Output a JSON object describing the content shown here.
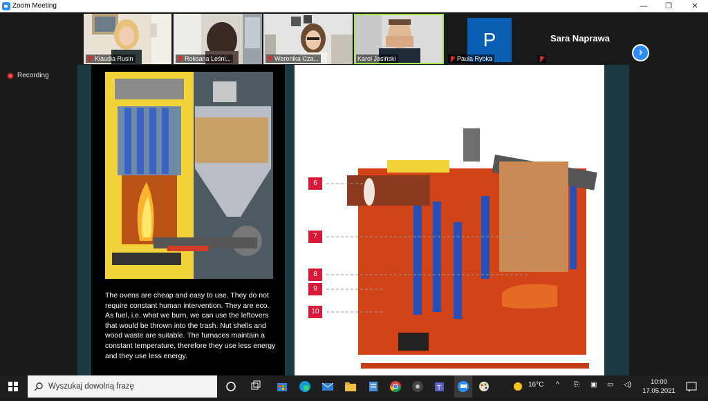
{
  "window": {
    "title": "Zoom Meeting",
    "controls": {
      "minimize": "—",
      "restore": "❐",
      "close": "✕"
    }
  },
  "participants": [
    {
      "name": "Klaudia Rusin",
      "muted": true,
      "video": true
    },
    {
      "name": "Roksana Leśni...",
      "muted": true,
      "video": true
    },
    {
      "name": "Weronika Cza...",
      "muted": true,
      "video": true
    },
    {
      "name": "Karol Jasiński",
      "muted": false,
      "video": true,
      "speaking": true
    },
    {
      "name": "Paula Rybka",
      "muted": true,
      "video": false,
      "avatar_letter": "P",
      "avatar_color": "#0a5fb4"
    },
    {
      "name": "Sara Naprawa",
      "muted": true,
      "video": false
    }
  ],
  "recording": {
    "label": "Recording"
  },
  "next_button": {
    "glyph": "›"
  },
  "slide": {
    "body_text": "The ovens are cheap and easy to use. They do not require constant human intervention. They are eco. As fuel, i.e. what we burn, we can use the leftovers that would be thrown into the trash. Nut shells and wood waste are suitable. The furnaces maintain a constant temperature, therefore they use less energy and they use less energy.",
    "callouts": [
      "6",
      "7",
      "8",
      "9",
      "10"
    ],
    "callout_color": "#d8193a"
  },
  "taskbar": {
    "search_placeholder": "Wyszukaj dowolną frazę",
    "weather": "16°C",
    "time": "10:00",
    "date": "17.05.2021",
    "apps": [
      "task-view",
      "microsoft-store",
      "edge",
      "mail",
      "file-explorer",
      "notepad",
      "chrome",
      "teams-helper",
      "teams",
      "zoom",
      "paint"
    ]
  },
  "colors": {
    "zoom_blue": "#2d8cff",
    "speaking_border": "#a5e64b",
    "mute_red": "#e02828",
    "share_bg": "#1c3942"
  }
}
